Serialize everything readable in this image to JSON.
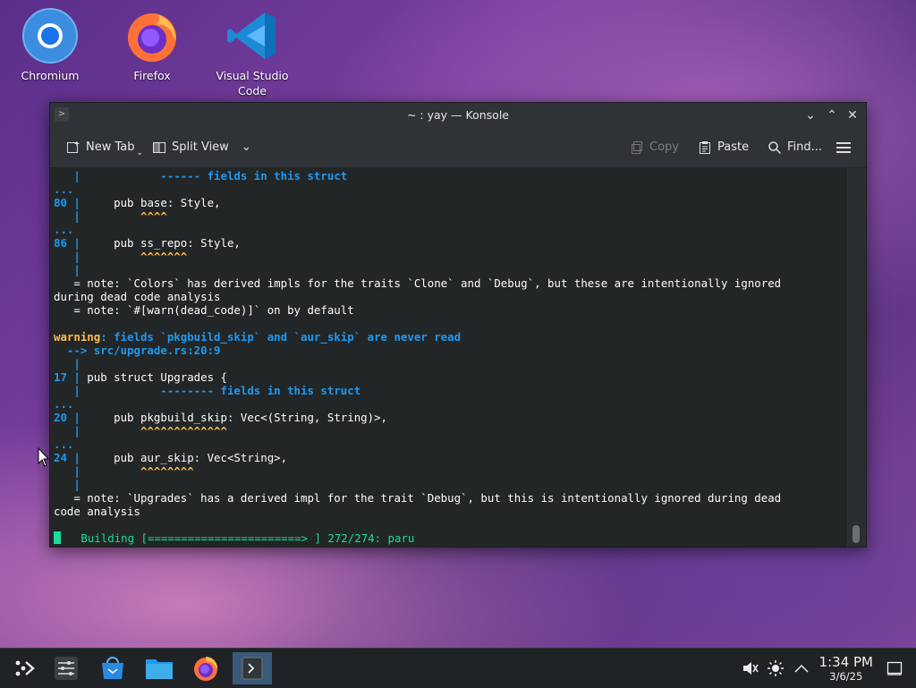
{
  "desktop": {
    "icons": [
      {
        "label": "Chromium",
        "icon": "chromium-icon"
      },
      {
        "label": "Firefox",
        "icon": "firefox-icon"
      },
      {
        "label": "Visual Studio Code",
        "icon": "vscode-icon"
      }
    ]
  },
  "window": {
    "title": "~ : yay — Konsole",
    "toolbar": {
      "new_tab": "New Tab",
      "split_view": "Split View",
      "copy": "Copy",
      "paste": "Paste",
      "find": "Find..."
    }
  },
  "terminal": {
    "lines": [
      {
        "gutter": "   |",
        "code": "            ------ fields in this struct"
      },
      {
        "gutter": "...",
        "code": ""
      },
      {
        "gutter": "80 |",
        "code": "     pub base: Style,"
      },
      {
        "gutter": "   |",
        "code": "         ^^^^"
      },
      {
        "gutter": "...",
        "code": ""
      },
      {
        "gutter": "86 |",
        "code": "     pub ss_repo: Style,"
      },
      {
        "gutter": "   |",
        "code": "         ^^^^^^^"
      },
      {
        "gutter": "   |",
        "code": ""
      },
      {
        "note1": "   = note: `Colors` has derived impls for the traits `Clone` and `Debug`, but these are intentionally ignored"
      },
      {
        "note1b": "during dead code analysis"
      },
      {
        "note2": "   = note: `#[warn(dead_code)]` on by default"
      },
      {
        "warning_label": "warning",
        "warning_msg": ": fields `pkgbuild_skip` and `aur_skip` are never read"
      },
      {
        "arrow": "  --> src/upgrade.rs:20:9"
      },
      {
        "gutter": "   |",
        "code": ""
      },
      {
        "gutter": "17 |",
        "code": " pub struct Upgrades {"
      },
      {
        "gutter": "   |",
        "code": "            -------- fields in this struct"
      },
      {
        "gutter": "...",
        "code": ""
      },
      {
        "gutter": "20 |",
        "code": "     pub pkgbuild_skip: Vec<(String, String)>,"
      },
      {
        "gutter": "   |",
        "code": "         ^^^^^^^^^^^^^"
      },
      {
        "gutter": "...",
        "code": ""
      },
      {
        "gutter": "24 |",
        "code": "     pub aur_skip: Vec<String>,"
      },
      {
        "gutter": "   |",
        "code": "         ^^^^^^^^"
      },
      {
        "gutter": "   |",
        "code": ""
      },
      {
        "note3": "   = note: `Upgrades` has a derived impl for the trait `Debug`, but this is intentionally ignored during dead"
      },
      {
        "note3b": "code analysis"
      },
      {
        "building": "   Building [=======================> ] 272/274: paru"
      }
    ]
  },
  "taskbar": {
    "clock_time": "1:34 PM",
    "clock_date": "3/6/25"
  }
}
